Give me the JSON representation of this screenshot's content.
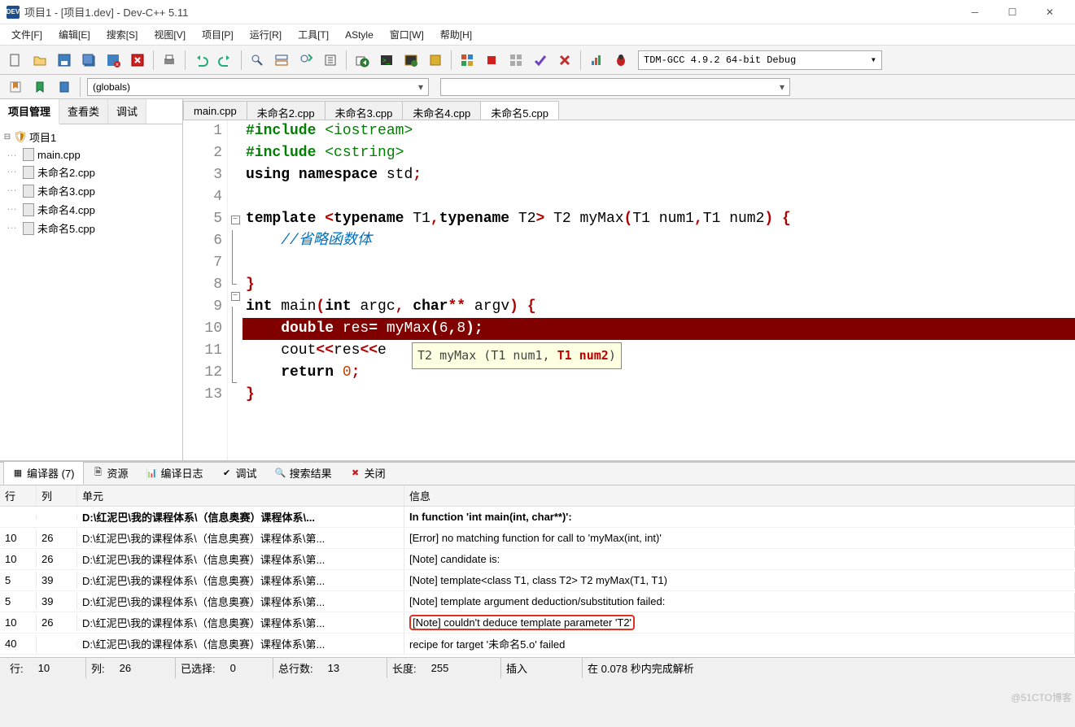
{
  "title": "项目1 - [项目1.dev] - Dev-C++ 5.11",
  "menus": [
    "文件[F]",
    "编辑[E]",
    "搜索[S]",
    "视图[V]",
    "项目[P]",
    "运行[R]",
    "工具[T]",
    "AStyle",
    "窗口[W]",
    "帮助[H]"
  ],
  "compiler_select": "TDM-GCC 4.9.2 64-bit Debug",
  "globals_dd": "(globals)",
  "side_tabs": [
    "项目管理",
    "查看类",
    "调试"
  ],
  "project_name": "项目1",
  "files": [
    "main.cpp",
    "未命名2.cpp",
    "未命名3.cpp",
    "未命名4.cpp",
    "未命名5.cpp"
  ],
  "editor_tabs": [
    "main.cpp",
    "未命名2.cpp",
    "未命名3.cpp",
    "未命名4.cpp",
    "未命名5.cpp"
  ],
  "tooltip": {
    "pre": "T2 myMax (T1 num1, ",
    "hl": "T1 num2",
    "post": ")"
  },
  "btm_tabs": [
    {
      "label": "编译器 (7)",
      "active": true
    },
    {
      "label": "资源",
      "active": false
    },
    {
      "label": "编译日志",
      "active": false
    },
    {
      "label": "调试",
      "active": false
    },
    {
      "label": "搜索结果",
      "active": false
    },
    {
      "label": "关闭",
      "active": false
    }
  ],
  "ct_head": {
    "line": "行",
    "col": "列",
    "unit": "单元",
    "msg": "信息"
  },
  "ct_rows": [
    {
      "line": "",
      "col": "",
      "unit": "D:\\红泥巴\\我的课程体系\\（信息奥赛）课程体系\\...",
      "msg": "In function 'int main(int, char**)':",
      "bold": true
    },
    {
      "line": "10",
      "col": "26",
      "unit": "D:\\红泥巴\\我的课程体系\\（信息奥赛）课程体系\\第...",
      "msg": "[Error] no matching function for call to 'myMax(int, int)'"
    },
    {
      "line": "10",
      "col": "26",
      "unit": "D:\\红泥巴\\我的课程体系\\（信息奥赛）课程体系\\第...",
      "msg": "[Note] candidate is:"
    },
    {
      "line": "5",
      "col": "39",
      "unit": "D:\\红泥巴\\我的课程体系\\（信息奥赛）课程体系\\第...",
      "msg": "[Note] template<class T1, class T2> T2 myMax(T1, T1)"
    },
    {
      "line": "5",
      "col": "39",
      "unit": "D:\\红泥巴\\我的课程体系\\（信息奥赛）课程体系\\第...",
      "msg": "[Note] template argument deduction/substitution failed:"
    },
    {
      "line": "10",
      "col": "26",
      "unit": "D:\\红泥巴\\我的课程体系\\（信息奥赛）课程体系\\第...",
      "msg": "[Note] couldn't deduce template parameter 'T2'",
      "hl": true
    },
    {
      "line": "40",
      "col": "",
      "unit": "D:\\红泥巴\\我的课程体系\\（信息奥赛）课程体系\\第...",
      "msg": "recipe for target '未命名5.o' failed"
    }
  ],
  "status": {
    "line_lbl": "行:",
    "line": "10",
    "col_lbl": "列:",
    "col": "26",
    "sel_lbl": "已选择:",
    "sel": "0",
    "tot_lbl": "总行数:",
    "tot": "13",
    "len_lbl": "长度:",
    "len": "255",
    "ins": "插入",
    "parse": "在 0.078 秒内完成解析"
  },
  "watermark": "@51CTO博客"
}
